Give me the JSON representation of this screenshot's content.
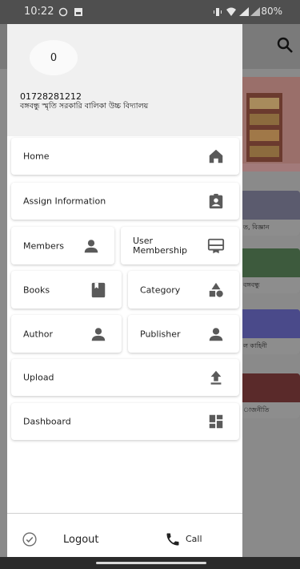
{
  "status_bar": {
    "time": "10:22",
    "battery": "80%"
  },
  "drawer": {
    "avatar_text": "0",
    "phone": "01728281212",
    "school": "বঙ্গবন্ধু স্মৃতি সরকারি বালিকা উচ্চ বিদ্যালয়",
    "menu": {
      "home": "Home",
      "assign_information": "Assign Information",
      "members": "Members",
      "user_membership_line1": "User",
      "user_membership_line2": "Membership",
      "books": "Books",
      "category": "Category",
      "author": "Author",
      "publisher": "Publisher",
      "upload": "Upload",
      "dashboard": "Dashboard"
    },
    "footer": {
      "logout": "Logout",
      "call": "Call"
    }
  },
  "background": {
    "cards": [
      "ত, বিজ্ঞান",
      "বঙ্গবন্ধু",
      "ল কাহিনী",
      "াজনীতি"
    ]
  },
  "colors": {
    "icon": "#5a5a5a",
    "drawer_header": "#f0f0f0",
    "scrim": "#8a8a8a"
  }
}
